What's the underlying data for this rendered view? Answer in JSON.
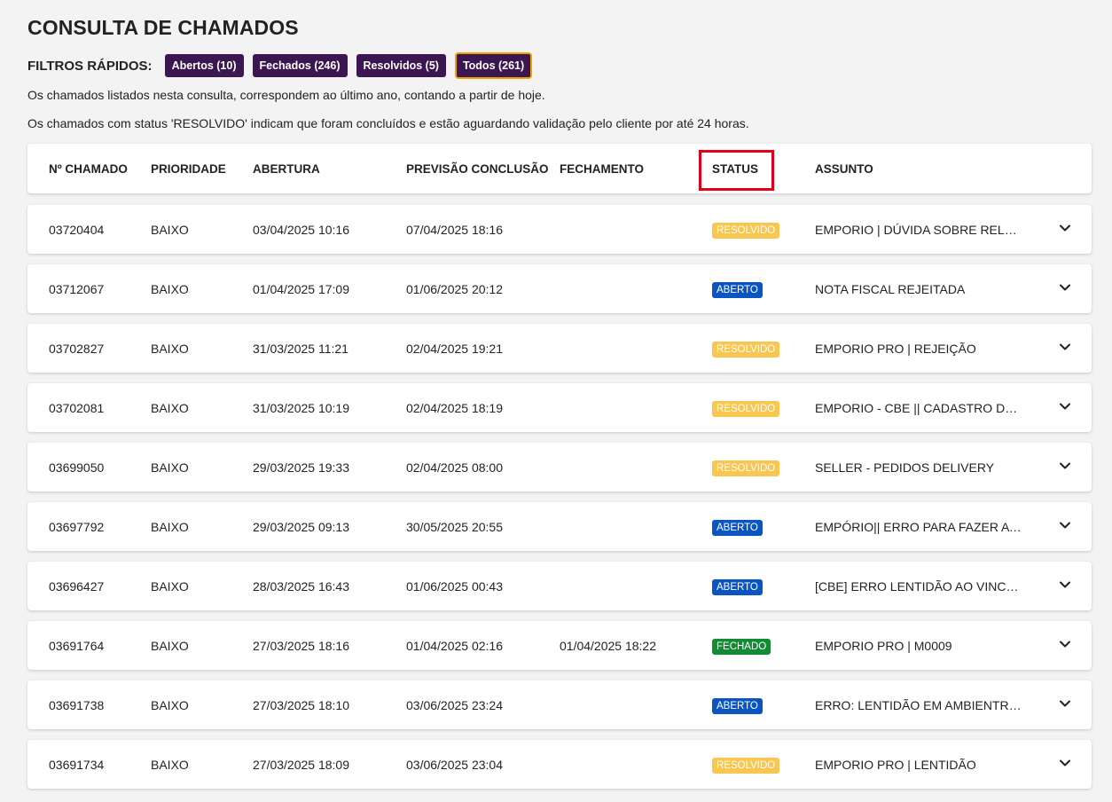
{
  "title": "CONSULTA DE CHAMADOS",
  "filters": {
    "label": "FILTROS RÁPIDOS:",
    "chips": [
      {
        "label": "Abertos (10)"
      },
      {
        "label": "Fechados (246)"
      },
      {
        "label": "Resolvidos (5)"
      },
      {
        "label": "Todos (261)",
        "active": true
      }
    ]
  },
  "notes": [
    "Os chamados listados nesta consulta, correspondem ao último ano, contando a partir de hoje.",
    "Os chamados com status 'RESOLVIDO' indicam que foram concluídos e estão aguardando validação pelo cliente por até 24 horas."
  ],
  "table": {
    "columns": [
      "Nº CHAMADO",
      "PRIORIDADE",
      "ABERTURA",
      "PREVISÃO CONCLUSÃO",
      "FECHAMENTO",
      "STATUS",
      "ASSUNTO"
    ],
    "rows": [
      {
        "id": "03720404",
        "prioridade": "BAIXO",
        "abertura": "03/04/2025 10:16",
        "previsao": "07/04/2025 18:16",
        "fechamento": "",
        "status": "RESOLVIDO",
        "assunto": "EMPORIO | DÚVIDA SOBRE RELATÓ..."
      },
      {
        "id": "03712067",
        "prioridade": "BAIXO",
        "abertura": "01/04/2025 17:09",
        "previsao": "01/06/2025 20:12",
        "fechamento": "",
        "status": "ABERTO",
        "assunto": "NOTA FISCAL REJEITADA"
      },
      {
        "id": "03702827",
        "prioridade": "BAIXO",
        "abertura": "31/03/2025 11:21",
        "previsao": "02/04/2025 19:21",
        "fechamento": "",
        "status": "RESOLVIDO",
        "assunto": "EMPORIO PRO | REJEIÇÃO"
      },
      {
        "id": "03702081",
        "prioridade": "BAIXO",
        "abertura": "31/03/2025 10:19",
        "previsao": "02/04/2025 18:19",
        "fechamento": "",
        "status": "RESOLVIDO",
        "assunto": "EMPORIO - CBE || CADASTRO DE F..."
      },
      {
        "id": "03699050",
        "prioridade": "BAIXO",
        "abertura": "29/03/2025 19:33",
        "previsao": "02/04/2025 08:00",
        "fechamento": "",
        "status": "RESOLVIDO",
        "assunto": "SELLER - PEDIDOS DELIVERY"
      },
      {
        "id": "03697792",
        "prioridade": "BAIXO",
        "abertura": "29/03/2025 09:13",
        "previsao": "30/05/2025 20:55",
        "fechamento": "",
        "status": "ABERTO",
        "assunto": "EMPÓRIO|| ERRO PARA FAZER A C..."
      },
      {
        "id": "03696427",
        "prioridade": "BAIXO",
        "abertura": "28/03/2025 16:43",
        "previsao": "01/06/2025 00:43",
        "fechamento": "",
        "status": "ABERTO",
        "assunto": "[CBE] ERRO LENTIDÃO AO VINCUL..."
      },
      {
        "id": "03691764",
        "prioridade": "BAIXO",
        "abertura": "27/03/2025 18:16",
        "previsao": "01/04/2025 02:16",
        "fechamento": "01/04/2025 18:22",
        "status": "FECHADO",
        "assunto": "EMPORIO PRO | M0009"
      },
      {
        "id": "03691738",
        "prioridade": "BAIXO",
        "abertura": "27/03/2025 18:10",
        "previsao": "03/06/2025 23:24",
        "fechamento": "",
        "status": "ABERTO",
        "assunto": "ERRO: LENTIDÃO EM AMBIENTRE ..."
      },
      {
        "id": "03691734",
        "prioridade": "BAIXO",
        "abertura": "27/03/2025 18:09",
        "previsao": "03/06/2025 23:04",
        "fechamento": "",
        "status": "RESOLVIDO",
        "assunto": "EMPORIO PRO | LENTIDÃO"
      }
    ]
  },
  "colors": {
    "chip_bg": "#3b1650",
    "chip_active_border": "#f5a000",
    "status_resolvido": "#f9c64f",
    "status_aberto": "#0a55c2",
    "status_fechado": "#138a34",
    "highlight": "#e0001a"
  },
  "icons": {
    "expand": "chevron-down-icon"
  }
}
